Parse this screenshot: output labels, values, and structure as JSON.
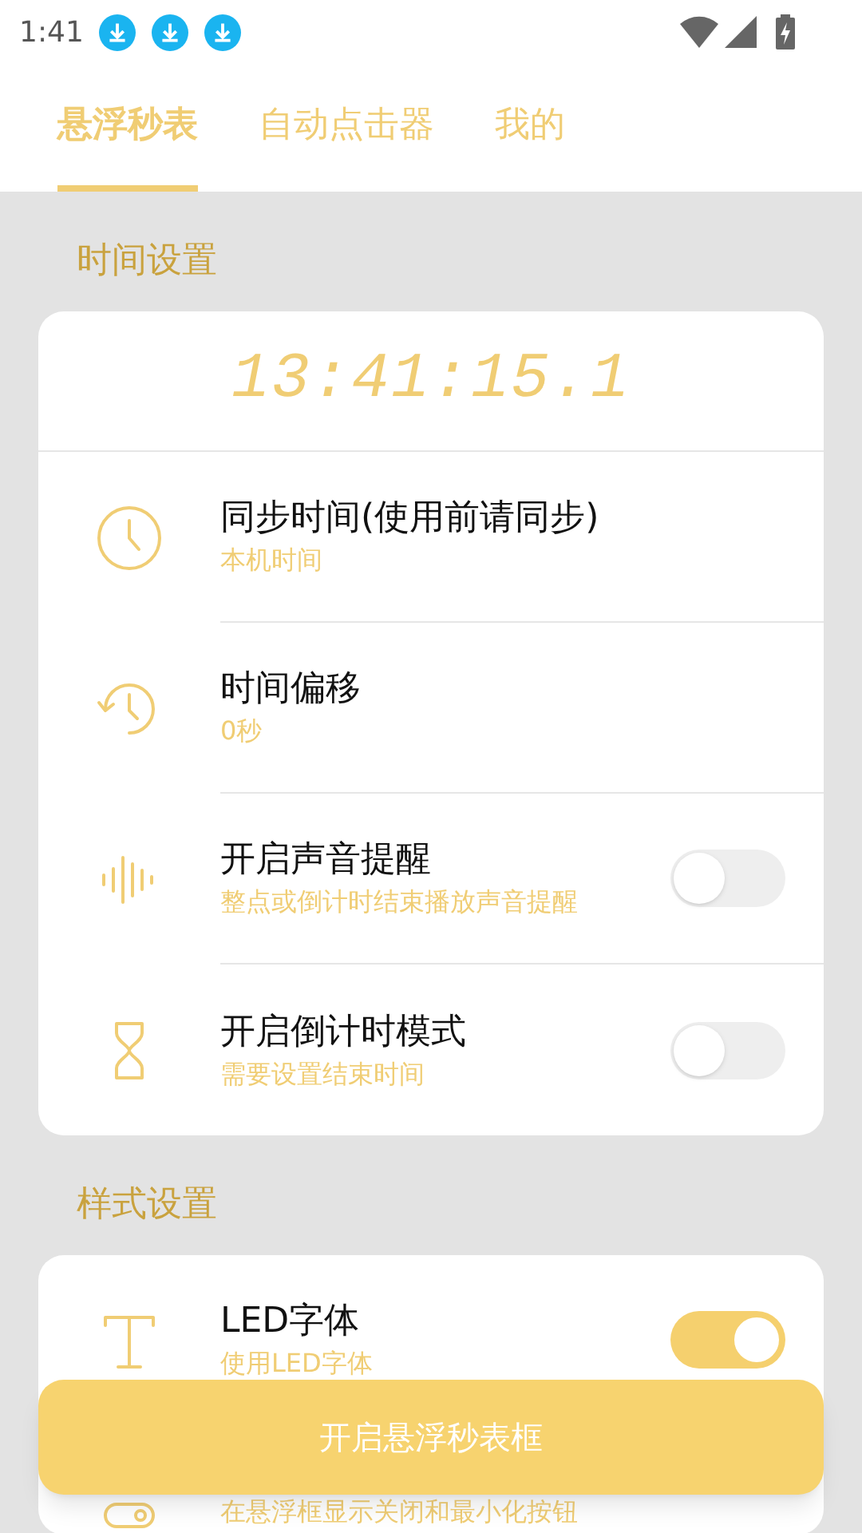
{
  "status_bar": {
    "time": "1:41"
  },
  "tabs": [
    {
      "label": "悬浮秒表",
      "selected": true
    },
    {
      "label": "自动点击器",
      "selected": false
    },
    {
      "label": "我的",
      "selected": false
    }
  ],
  "sections": [
    {
      "title": "时间设置",
      "clock": "13:41:15.1",
      "items": [
        {
          "title": "同步时间(使用前请同步)",
          "subtitle": "本机时间",
          "kind": "link"
        },
        {
          "title": "时间偏移",
          "subtitle": "0秒",
          "kind": "link"
        },
        {
          "title": "开启声音提醒",
          "subtitle": "整点或倒计时结束播放声音提醒",
          "kind": "toggle",
          "on": false
        },
        {
          "title": "开启倒计时模式",
          "subtitle": "需要设置结束时间",
          "kind": "toggle",
          "on": false
        }
      ]
    },
    {
      "title": "样式设置",
      "items": [
        {
          "title": "LED字体",
          "subtitle": "使用LED字体",
          "kind": "toggle",
          "on": true
        },
        {
          "subtitle": "在悬浮框显示关闭和最小化按钮",
          "kind": "partial"
        }
      ]
    }
  ],
  "action_button": "开启悬浮秒表框"
}
